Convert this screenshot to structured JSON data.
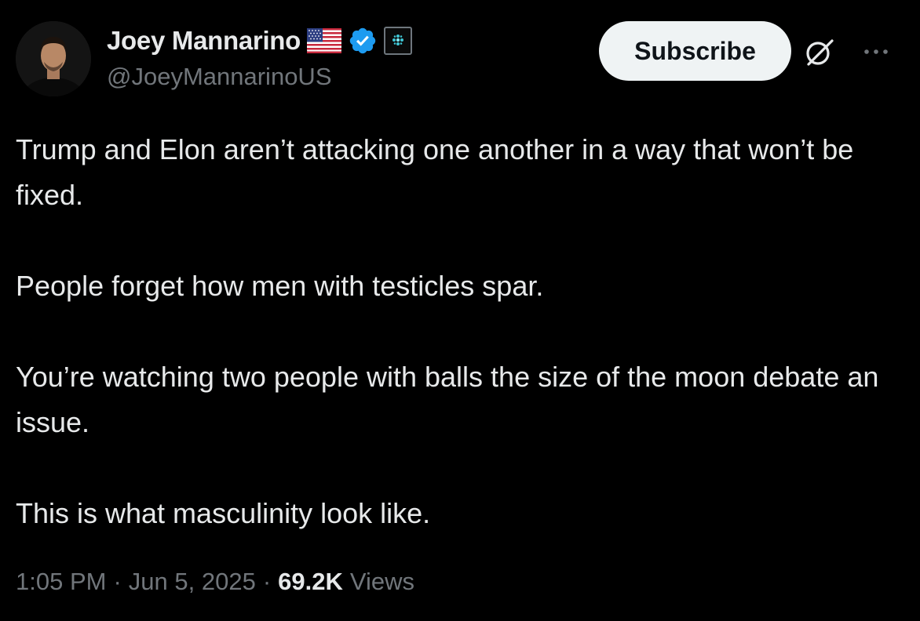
{
  "author": {
    "display_name": "Joey Mannarino",
    "handle": "@JoeyMannarinoUS",
    "badges": [
      "us-flag-icon",
      "verified-badge-icon",
      "affiliate-badge-icon"
    ]
  },
  "actions": {
    "subscribe_label": "Subscribe",
    "grok_icon": "grok-icon",
    "more_icon": "more-options-icon"
  },
  "tweet": {
    "paragraphs": [
      "Trump and Elon aren’t attacking one another in a way that won’t be fixed.",
      "People forget how men with testicles spar.",
      "You’re watching two people with balls the size of the moon debate an issue.",
      "This is what masculinity look like."
    ]
  },
  "meta": {
    "time": "1:05 PM",
    "separator": "·",
    "date": "Jun 5, 2025",
    "views_count": "69.2K",
    "views_label": "Views"
  },
  "colors": {
    "background": "#000000",
    "text_primary": "#e7e9ea",
    "text_secondary": "#71767b",
    "verified_blue": "#1d9bf0",
    "button_bg": "#eff3f4"
  }
}
